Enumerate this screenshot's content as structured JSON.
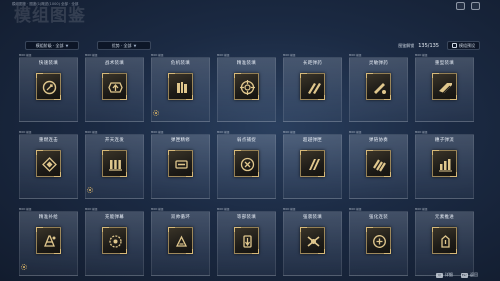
{
  "page": {
    "title": "模组图鉴",
    "breadcrumb": "模组图鉴 · 图鉴(1)概述(1000) 全部 · 全部"
  },
  "filters": [
    {
      "label": "模组阶级 · 全部",
      "caret": "▼"
    },
    {
      "label": "优势 · 全部",
      "caret": "▼"
    }
  ],
  "collection": {
    "label": "图鉴解锁",
    "count": "135/135",
    "plan_label": "模组预设"
  },
  "cards": [
    {
      "tag": "MOD 模组",
      "name": "快速装填",
      "icon": "reload-icon",
      "gear": false
    },
    {
      "tag": "MOD 模组",
      "name": "战术装填",
      "icon": "tactical-reload-icon",
      "gear": false
    },
    {
      "tag": "MOD 模组",
      "name": "危机装填",
      "icon": "crisis-reload-icon",
      "gear": true
    },
    {
      "tag": "MOD 模组",
      "name": "精准装填",
      "icon": "precision-reload-icon",
      "gear": false
    },
    {
      "tag": "MOD 模组",
      "name": "长距弹药",
      "icon": "long-range-ammo-icon",
      "gear": false
    },
    {
      "tag": "MOD 模组",
      "name": "灵敏弹药",
      "icon": "agile-ammo-icon",
      "gear": false
    },
    {
      "tag": "MOD 模组",
      "name": "重型装填",
      "icon": "heavy-reload-icon",
      "gear": false
    },
    {
      "tag": "MOD 模组",
      "name": "重燃连击",
      "icon": "combo-icon",
      "gear": false
    },
    {
      "tag": "MOD 模组",
      "name": "开天连发",
      "icon": "burst-fire-icon",
      "gear": true
    },
    {
      "tag": "MOD 模组",
      "name": "弹匣精修",
      "icon": "magazine-icon",
      "gear": false
    },
    {
      "tag": "MOD 模组",
      "name": "弱点捕捉",
      "icon": "weakpoint-icon",
      "gear": false
    },
    {
      "tag": "MOD 模组",
      "name": "超越弹匣",
      "icon": "overflow-magazine-icon",
      "gear": false
    },
    {
      "tag": "MOD 模组",
      "name": "弹链协奏",
      "icon": "ammo-chain-icon",
      "gear": false
    },
    {
      "tag": "MOD 模组",
      "name": "穗子弹流",
      "icon": "bullet-stream-icon",
      "gear": false
    },
    {
      "tag": "MOD 模组",
      "name": "精准补给",
      "icon": "precision-supply-icon",
      "gear": true
    },
    {
      "tag": "MOD 模组",
      "name": "充能弹幕",
      "icon": "charged-barrage-icon",
      "gear": false
    },
    {
      "tag": "MOD 模组",
      "name": "双帅循环",
      "icon": "cycle-icon",
      "gear": false
    },
    {
      "tag": "MOD 模组",
      "name": "等部装填",
      "icon": "partial-reload-icon",
      "gear": false
    },
    {
      "tag": "MOD 模组",
      "name": "强袭装填",
      "icon": "assault-reload-icon",
      "gear": false
    },
    {
      "tag": "MOD 模组",
      "name": "强化连装",
      "icon": "enhanced-reload-icon",
      "gear": false
    },
    {
      "tag": "MOD 模组",
      "name": "元素推进",
      "icon": "element-push-icon",
      "gear": false
    }
  ],
  "hints": [
    {
      "key": "Q",
      "label": "详细"
    },
    {
      "key": "Esc",
      "label": "返回"
    }
  ],
  "colors": {
    "accent_gold": "#d7b978",
    "background": "#1b2a43"
  }
}
